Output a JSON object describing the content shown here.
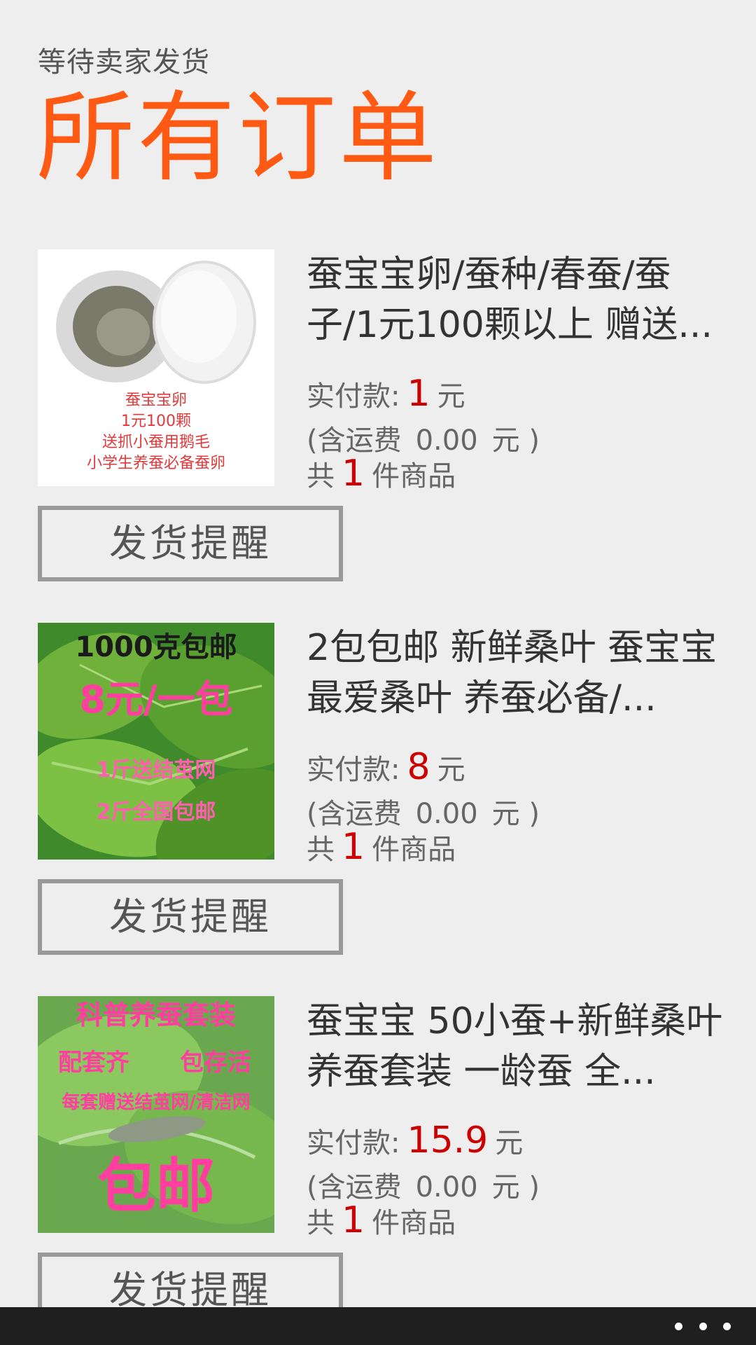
{
  "header": {
    "subtitle": "等待卖家发货",
    "title": "所有订单"
  },
  "labels": {
    "paid_prefix": "实付款:",
    "currency_unit": "元",
    "shipping_prefix": "(含运费",
    "shipping_suffix": "元 )",
    "count_prefix": "共",
    "count_suffix": "件商品",
    "remind_button": "发货提醒"
  },
  "orders": [
    {
      "name": "蚕宝宝卵/蚕种/春蚕/蚕子/1元100颗以上 赠送...",
      "paid": "1",
      "shipping": "0.00",
      "count": "1",
      "image_text": [
        "蚕宝宝卵",
        "1元100颗",
        "送抓小蚕用鹅毛",
        "小学生养蚕必备蚕卵"
      ],
      "image_theme": "eggs"
    },
    {
      "name": "2包包邮 新鲜桑叶 蚕宝宝最爱桑叶 养蚕必备/...",
      "paid": "8",
      "shipping": "0.00",
      "count": "1",
      "image_text": [
        "1000克包邮",
        "8元/一包",
        "1斤送结茧网",
        "2斤全国包邮"
      ],
      "image_theme": "leaves"
    },
    {
      "name": "蚕宝宝 50小蚕+新鲜桑叶 养蚕套装 一龄蚕 全...",
      "paid": "15.9",
      "shipping": "0.00",
      "count": "1",
      "image_text": [
        "科普养蚕套装",
        "配套齐",
        "包存活",
        "每套赠送结茧网/清洁网",
        "包邮"
      ],
      "image_theme": "kit"
    }
  ],
  "colors": {
    "accent": "#ff5a14",
    "price": "#cc0000",
    "background": "#eeeeee",
    "appbar": "#1f1f1f"
  },
  "icons": {
    "more": "more-dots-icon"
  }
}
